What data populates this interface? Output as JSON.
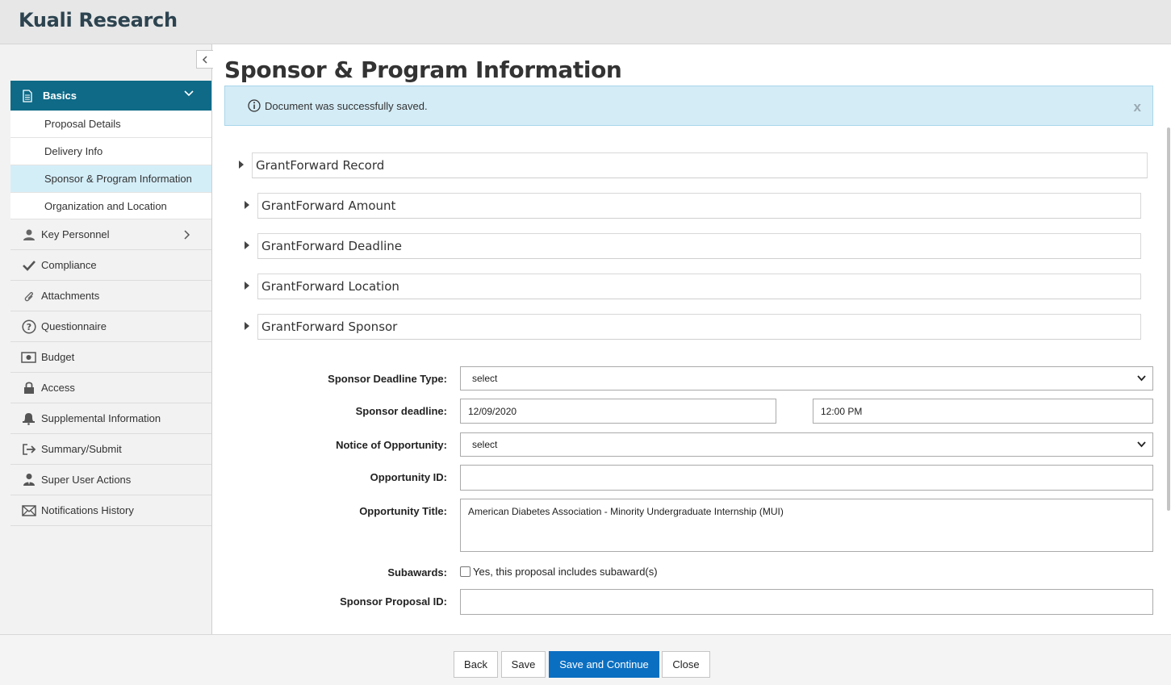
{
  "app": {
    "title": "Kuali Research"
  },
  "sidebar": {
    "basics": {
      "label": "Basics",
      "sub_items": [
        {
          "label": "Proposal Details"
        },
        {
          "label": "Delivery Info"
        },
        {
          "label": "Sponsor & Program Information",
          "active": true
        },
        {
          "label": "Organization and Location"
        }
      ]
    },
    "items": [
      {
        "label": "Key Personnel",
        "icon": "user-icon"
      },
      {
        "label": "Compliance",
        "icon": "check-icon"
      },
      {
        "label": "Attachments",
        "icon": "paperclip-icon"
      },
      {
        "label": "Questionnaire",
        "icon": "question-circle-icon"
      },
      {
        "label": "Budget",
        "icon": "money-icon"
      },
      {
        "label": "Access",
        "icon": "lock-icon"
      },
      {
        "label": "Supplemental Information",
        "icon": "bell-icon"
      },
      {
        "label": "Summary/Submit",
        "icon": "sign-out-icon"
      },
      {
        "label": "Super User Actions",
        "icon": "user-tie-icon"
      },
      {
        "label": "Notifications History",
        "icon": "envelope-icon"
      }
    ]
  },
  "main": {
    "page_title": "Sponsor & Program Information",
    "alert": "Document was successfully saved.",
    "alert_close": "x",
    "sections": [
      {
        "label": "GrantForward Record"
      },
      {
        "label": "GrantForward Amount"
      },
      {
        "label": "GrantForward Deadline"
      },
      {
        "label": "GrantForward Location"
      },
      {
        "label": "GrantForward Sponsor"
      }
    ],
    "form": {
      "deadline_type_label": "Sponsor Deadline Type:",
      "deadline_type_value": "select",
      "deadline_label": "Sponsor deadline:",
      "deadline_date": "12/09/2020",
      "deadline_time": "12:00 PM",
      "notice_label": "Notice of Opportunity:",
      "notice_value": "select",
      "opportunity_id_label": "Opportunity ID:",
      "opportunity_id_value": "",
      "opportunity_title_label": "Opportunity Title:",
      "opportunity_title_value": "American Diabetes Association - Minority Undergraduate Internship (MUI)",
      "subawards_label": "Subawards:",
      "subawards_checkbox_label": "Yes, this proposal includes subaward(s)",
      "sponsor_proposal_id_label": "Sponsor Proposal ID:",
      "sponsor_proposal_id_value": ""
    }
  },
  "footer": {
    "back": "Back",
    "save": "Save",
    "save_continue": "Save and Continue",
    "close": "Close"
  },
  "colors": {
    "nav_active": "#0e6a87",
    "sub_active": "#d4eef8",
    "primary_button": "#0b6fc1",
    "alert_bg": "#d4ecf6"
  }
}
